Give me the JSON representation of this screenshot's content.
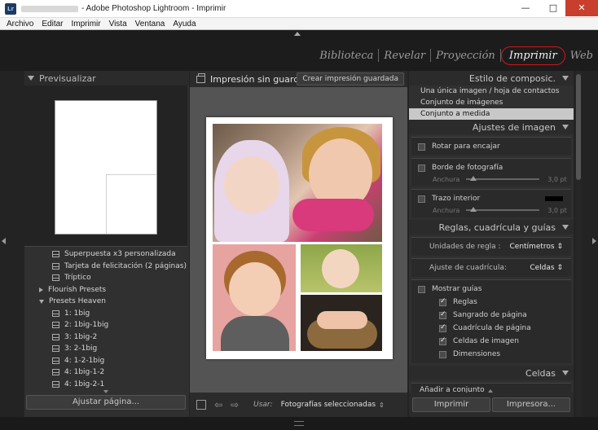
{
  "window": {
    "title": "- Adobe Photoshop Lightroom - Imprimir",
    "app_icon": "Lr",
    "min_glyph": "—",
    "max_glyph": "□",
    "close_glyph": "✕"
  },
  "menu": [
    "Archivo",
    "Editar",
    "Imprimir",
    "Vista",
    "Ventana",
    "Ayuda"
  ],
  "modules": [
    "Biblioteca",
    "Revelar",
    "Proyección",
    "Imprimir",
    "Web"
  ],
  "active_module": "Imprimir",
  "left_panel": {
    "preview_title": "Previsualizar",
    "templates": [
      {
        "type": "template",
        "label": "Superpuesta x3 personalizada"
      },
      {
        "type": "template",
        "label": "Tarjeta de felicitación (2 páginas)"
      },
      {
        "type": "template",
        "label": "Tríptico"
      },
      {
        "type": "folder",
        "label": "Flourish Presets",
        "expanded": false
      },
      {
        "type": "folder",
        "label": "Presets Heaven",
        "expanded": true
      },
      {
        "type": "template",
        "label": "1: 1big"
      },
      {
        "type": "template",
        "label": "2: 1big-1big"
      },
      {
        "type": "template",
        "label": "3: 1big-2"
      },
      {
        "type": "template",
        "label": "3: 2-1big"
      },
      {
        "type": "template",
        "label": "4: 1-2-1big"
      },
      {
        "type": "template",
        "label": "4: 1big-1-2"
      },
      {
        "type": "template",
        "label": "4: 1big-2-1"
      }
    ],
    "page_setup_button": "Ajustar página..."
  },
  "center": {
    "title": "Impresión sin guard...",
    "save_button": "Crear impresión guardada",
    "use_label": "Usar:",
    "use_value": "Fotografías seleccionadas",
    "use_caret": "⇕",
    "prev_glyph": "⇦",
    "next_glyph": "⇨"
  },
  "right_panel": {
    "layout_style": {
      "title": "Estilo de composic.",
      "options": [
        "Una única imagen / hoja de contactos",
        "Conjunto de imágenes",
        "Conjunto a medida"
      ],
      "selected": "Conjunto a medida"
    },
    "image_settings": {
      "title": "Ajustes de imagen",
      "rotate_label": "Rotar para encajar",
      "photo_border_label": "Borde de fotografía",
      "width_label": "Anchura",
      "border_width_value": "3,0 pt",
      "border_width_fraction": 0.1,
      "inner_stroke_label": "Trazo interior",
      "stroke_width_value": "3,0 pt",
      "stroke_width_fraction": 0.1,
      "stroke_color": "#000000"
    },
    "rulers": {
      "title": "Reglas, cuadrícula y guías",
      "ruler_units_label": "Unidades de regla :",
      "ruler_units_value": "Centímetros ⇕",
      "grid_snap_label": "Ajuste de cuadrícula:",
      "grid_snap_value": "Celdas ⇕",
      "show_guides_label": "Mostrar guías",
      "guides": [
        {
          "label": "Reglas",
          "checked": true
        },
        {
          "label": "Sangrado de página",
          "checked": true
        },
        {
          "label": "Cuadrícula de página",
          "checked": true
        },
        {
          "label": "Celdas de imagen",
          "checked": true
        },
        {
          "label": "Dimensiones",
          "checked": false
        }
      ]
    },
    "cells": {
      "title": "Celdas",
      "add_to_set": "Añadir a conjunto"
    },
    "print_button": "Imprimir",
    "printer_button": "Impresora..."
  },
  "colors": {
    "active_module_ring": "#d0161c",
    "panel_bg": "#303030",
    "canvas_bg": "#545454"
  }
}
